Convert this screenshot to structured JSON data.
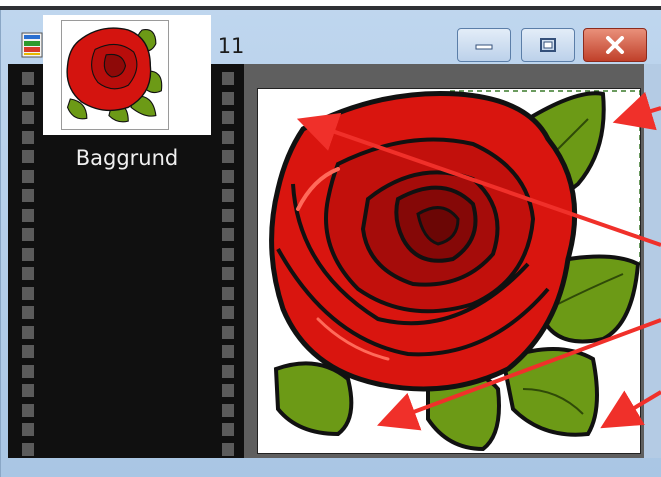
{
  "window": {
    "title": "Ikke navngivet 11",
    "icon": "image-document-icon",
    "controls": {
      "minimize": "minimize-icon",
      "maximize": "maximize-icon",
      "close": "close-icon"
    }
  },
  "layers": [
    {
      "label": "Baggrund",
      "thumbnail": "red-rose-thumbnail"
    }
  ],
  "canvas": {
    "image": "red-rose-with-green-leaves"
  },
  "colors": {
    "titlebar": "#bfd6ee",
    "close_button": "#c94a33",
    "film": "#101010",
    "annotation_arrows": "#f0302a"
  }
}
